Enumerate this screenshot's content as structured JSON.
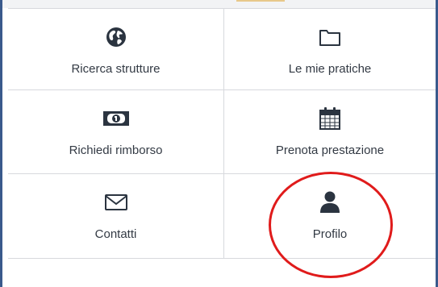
{
  "menu": {
    "items": [
      {
        "label": "Ricerca strutture",
        "icon": "globe-icon"
      },
      {
        "label": "Le mie pratiche",
        "icon": "folder-icon"
      },
      {
        "label": "Richiedi rimborso",
        "icon": "money-icon"
      },
      {
        "label": "Prenota prestazione",
        "icon": "calendar-icon"
      },
      {
        "label": "Contatti",
        "icon": "envelope-icon"
      },
      {
        "label": "Profilo",
        "icon": "user-icon"
      }
    ]
  },
  "colors": {
    "icon": "#2b3440",
    "text": "#333a44",
    "divider": "#d7d9dd",
    "highlight": "#e01b1b"
  }
}
